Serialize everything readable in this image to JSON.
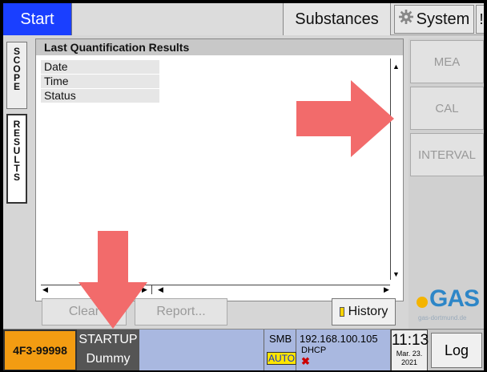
{
  "topbar": {
    "start_label": "Start",
    "substances_label": "Substances",
    "system_label": "System",
    "warning_label": "!",
    "system_icon": "gear-icon"
  },
  "side_tabs": {
    "scope": [
      "S",
      "C",
      "O",
      "P",
      "E"
    ],
    "results": [
      "R",
      "E",
      "S",
      "U",
      "L",
      "T",
      "S"
    ]
  },
  "panel": {
    "title": "Last Quantification Results",
    "rows": [
      "Date",
      "Time",
      "Status"
    ]
  },
  "buttons": {
    "clear_label": "Clear",
    "report_label": "Report...",
    "history_label": "History"
  },
  "right_menu": {
    "items": [
      "MEA",
      "CAL",
      "INTERVAL"
    ]
  },
  "logo": {
    "text": "GAS",
    "url": "gas-dortmund.de"
  },
  "status": {
    "device_id": "4F3-99998",
    "state_line1": "STARTUP",
    "state_line2": "Dummy",
    "smb_label": "SMB",
    "auto_label": "AUTO",
    "ip": "192.168.100.105",
    "dhcp": "DHCP",
    "error_icon": "✖",
    "time": "11:13",
    "date_line1": "Mar. 23.",
    "date_line2": "2021",
    "log_label": "Log"
  },
  "colors": {
    "start_tab": "#1a3fff",
    "device_id_bg": "#f39c12",
    "status_blue": "#a9b8e0",
    "arrow": "#f26b6b",
    "gas_blue": "#2d86c7",
    "gas_yellow": "#f4b400"
  }
}
